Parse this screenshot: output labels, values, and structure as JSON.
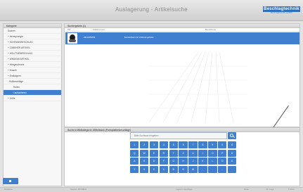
{
  "header": {
    "title": "Auslagerung - Artikelsuche",
    "logo_text": "Beschlagtechnik",
    "logo_subtext": "MUSTERMANN GMBH"
  },
  "sidebar": {
    "title": "Kategorie",
    "items": [
      {
        "label": "Suchen"
      },
      {
        "label": "+ Hemsprunger"
      },
      {
        "label": "+ SCHRANKBESCHLAG"
      },
      {
        "label": "+ ZUBEHÖR ARTIKEL"
      },
      {
        "label": "+ HOLZTÜRBESCHLAG"
      },
      {
        "label": "+ WINDOW ARTIKEL"
      },
      {
        "label": "+ Hängeschrank"
      },
      {
        "label": "+ Knaufe"
      },
      {
        "label": "+ Endkappen"
      },
      {
        "label": "- Rollbeschläge"
      },
      {
        "label": "Rollen"
      },
      {
        "label": "Laufschienen"
      },
      {
        "label": "+ Griffe"
      }
    ]
  },
  "main": {
    "title": "Suchergebnis (1)",
    "columns": [
      "Bild",
      "Artikelnummer",
      "Bezeichnung"
    ],
    "row": {
      "article_no": "ZZ123456789",
      "description": "Bombenbaron für Verbindungshülse"
    }
  },
  "keyboard": {
    "title": "Suche in Bildkategorie: Mittelblock (Formplattenbeschläge)",
    "search_placeholder": "Bitte Suchwort eingeben",
    "rows": [
      [
        "1",
        "2",
        "3",
        "4",
        "5",
        "6",
        "7",
        "8",
        "9",
        "0",
        "ß"
      ],
      [
        "Q",
        "W",
        "E",
        "R",
        "T",
        "Z",
        "U",
        "I",
        "O",
        "P",
        "Ü"
      ],
      [
        "A",
        "S",
        "D",
        "F",
        "G",
        "H",
        "J",
        "K",
        "L",
        "Ö",
        "Ä"
      ],
      [
        "Y",
        "X",
        "C",
        "V",
        "B",
        "N",
        "M",
        ",",
        ".",
        "-"
      ]
    ]
  },
  "footer": {
    "left": "Mitarbeiter",
    "mid1": "Session: ABCDEFG",
    "mid2": "Lagerort: Hauptlager",
    "right1": "Weiter",
    "right2": "V6 / Lager",
    "right3": "© 2014"
  },
  "colors": {
    "accent": "#3f7fd0",
    "header_bg": "#d8d8d8"
  }
}
